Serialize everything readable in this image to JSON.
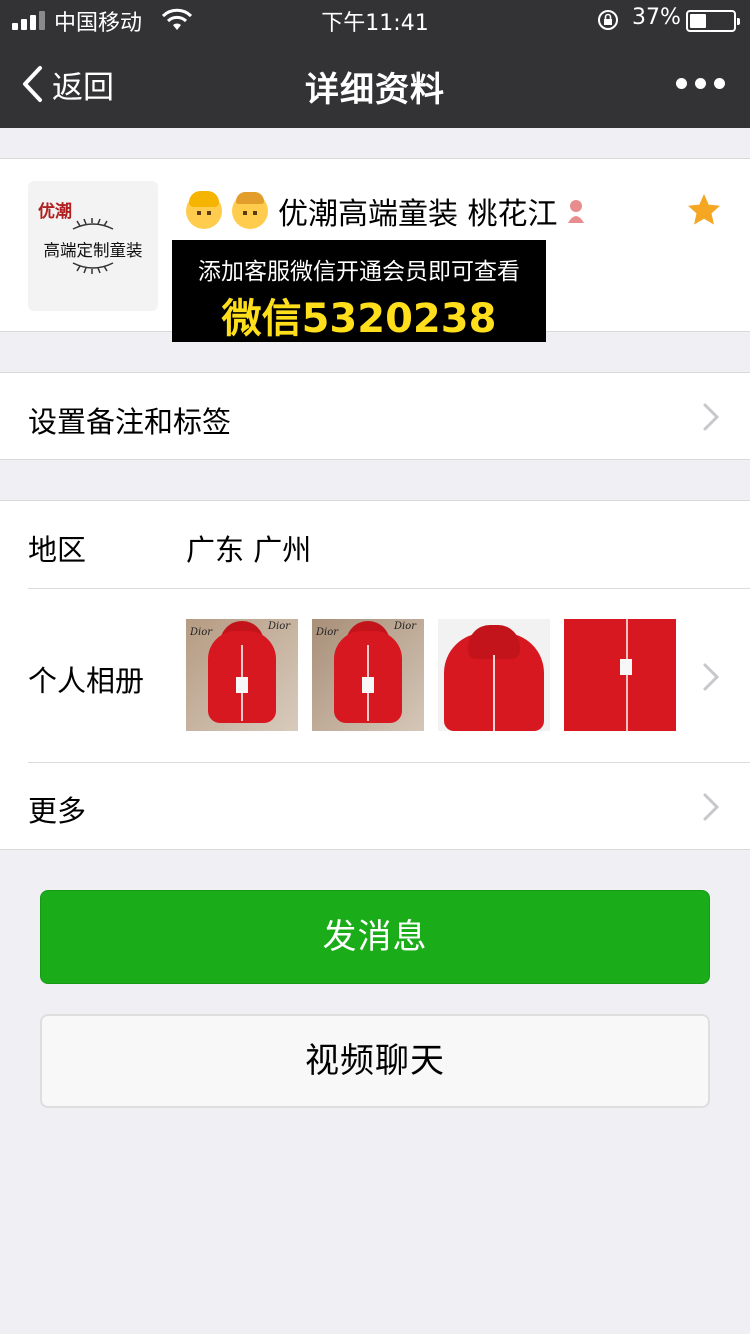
{
  "status_bar": {
    "carrier": "中国移动",
    "time": "下午11:41",
    "battery_percent": "37%",
    "battery_level": 0.37
  },
  "nav": {
    "back_label": "返回",
    "title": "详细资料"
  },
  "profile": {
    "avatar_text_top": "优潮",
    "avatar_text_main": "高端定制童装",
    "name": "优潮高端童装 桃花江",
    "starred": true,
    "name_icons": [
      "girl-emoji-icon",
      "boy-emoji-icon",
      "pin-icon"
    ]
  },
  "promo": {
    "line1": "添加客服微信开通会员即可查看",
    "line2": "微信5320238"
  },
  "remark": {
    "label": "设置备注和标签"
  },
  "info": {
    "region_label": "地区",
    "region_value": "广东 广州",
    "album_label": "个人相册",
    "album_brand": "Dior",
    "more_label": "更多"
  },
  "buttons": {
    "message": "发消息",
    "video_chat": "视频聊天"
  },
  "colors": {
    "nav_bg": "#333336",
    "accent_green": "#1aad19",
    "page_bg": "#efeff4",
    "star": "#f5a623",
    "promo_yellow": "#ffde1c"
  }
}
